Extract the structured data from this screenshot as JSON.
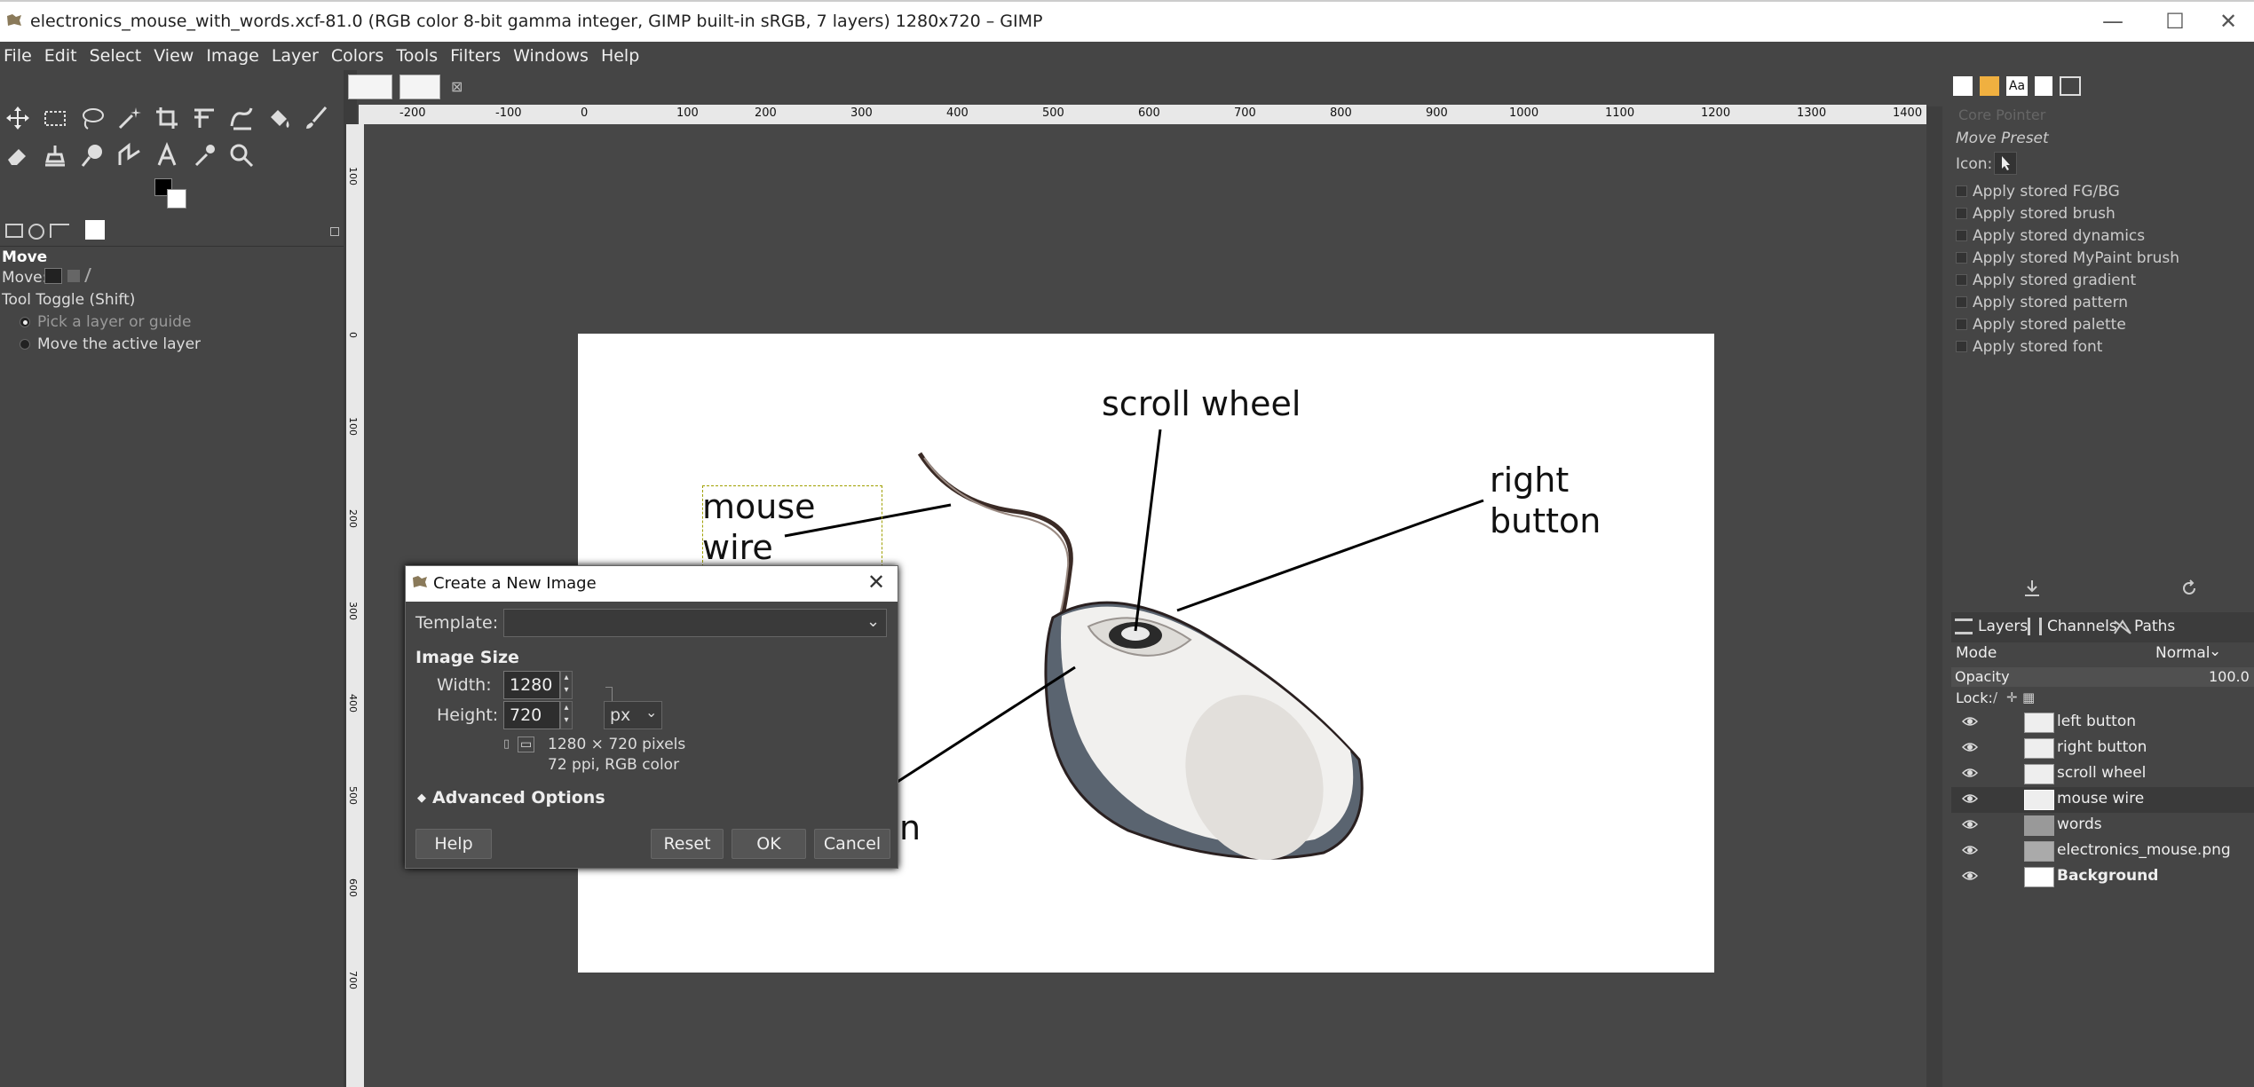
{
  "window": {
    "title": "electronics_mouse_with_words.xcf-81.0 (RGB color 8-bit gamma integer, GIMP built-in sRGB, 7 layers) 1280x720 – GIMP",
    "minimize": "—",
    "maximize": "☐",
    "close": "✕"
  },
  "menu": [
    "File",
    "Edit",
    "Select",
    "View",
    "Image",
    "Layer",
    "Colors",
    "Tools",
    "Filters",
    "Windows",
    "Help"
  ],
  "tool_options": {
    "title": "Move",
    "move_label": "Move:",
    "toggle_label": "Tool Toggle  (Shift)",
    "option1": "Pick a layer or guide",
    "option2": "Move the active layer"
  },
  "ruler_h": [
    "-200",
    "-100",
    "0",
    "100",
    "200",
    "300",
    "400",
    "500",
    "600",
    "700",
    "800",
    "900",
    "1000",
    "1100",
    "1200",
    "1300",
    "1400"
  ],
  "ruler_v": [
    "100",
    "0",
    "100",
    "200",
    "300",
    "400",
    "500",
    "600",
    "700"
  ],
  "canvas_labels": {
    "scroll_wheel": "scroll wheel",
    "right": "right",
    "button": "button",
    "mouse": "mouse",
    "wire": "wire",
    "partial_n": "n"
  },
  "dialog": {
    "title": "Create a New Image",
    "template_label": "Template:",
    "image_size_label": "Image Size",
    "width_label": "Width:",
    "width_value": "1280",
    "height_label": "Height:",
    "height_value": "720",
    "unit": "px",
    "info_pixels": "1280 × 720 pixels",
    "info_ppi": "72 ppi, RGB color",
    "advanced_label": "Advanced Options",
    "help": "Help",
    "reset": "Reset",
    "ok": "OK",
    "cancel": "Cancel"
  },
  "tool_presets": {
    "header": "Core Pointer",
    "move_preset": "Move Preset",
    "icon_label": "Icon:",
    "options": [
      "Apply stored FG/BG",
      "Apply stored brush",
      "Apply stored dynamics",
      "Apply stored MyPaint brush",
      "Apply stored gradient",
      "Apply stored pattern",
      "Apply stored palette",
      "Apply stored font"
    ]
  },
  "layers_panel": {
    "tab_layers": "Layers",
    "tab_channels": "Channels",
    "tab_paths": "Paths",
    "mode_label": "Mode",
    "mode_value": "Normal",
    "opacity_label": "Opacity",
    "opacity_value": "100.0",
    "lock_label": "Lock:",
    "layers": [
      "left button",
      "right button",
      "scroll wheel",
      "mouse wire",
      "words",
      "electronics_mouse.png",
      "Background"
    ]
  },
  "colors": {
    "bg": "#454545",
    "selected_layer": "#3a3a3a"
  }
}
